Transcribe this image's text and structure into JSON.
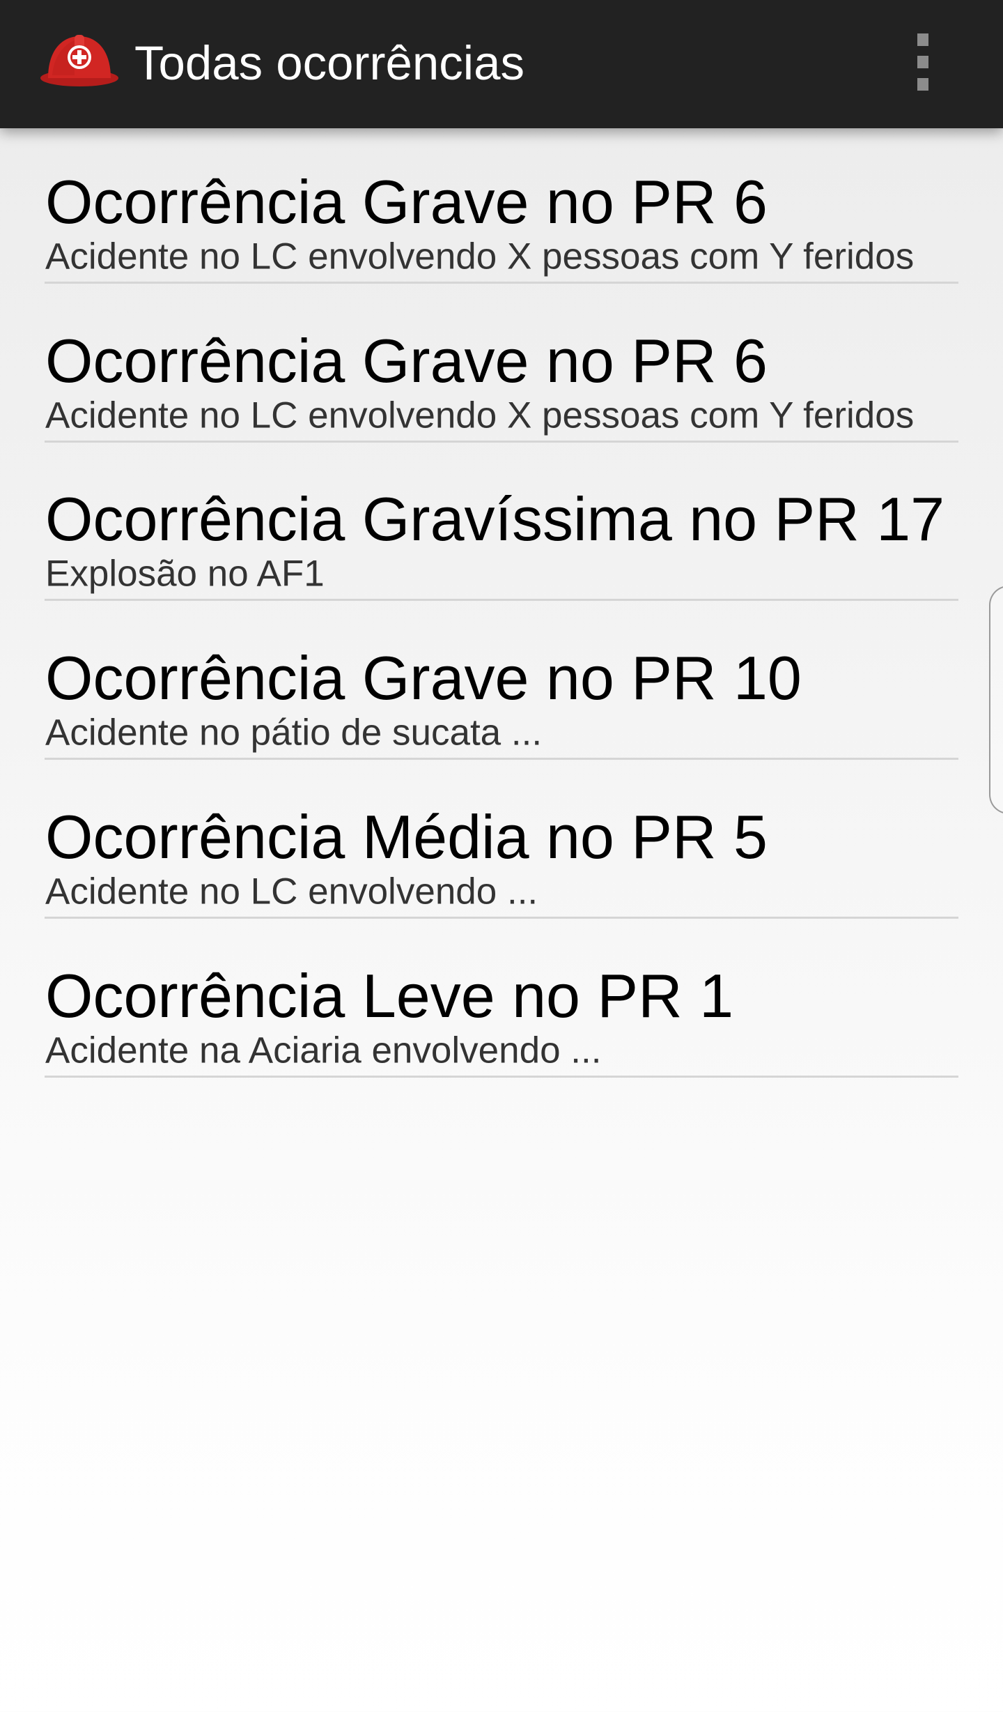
{
  "app_bar": {
    "title": "Todas ocorrências",
    "icon": "safety-helmet-icon",
    "menu_icon": "overflow-menu-icon",
    "background_color": "#222222"
  },
  "incidents": [
    {
      "title": "Ocorrência Grave no PR 6",
      "subtitle": "Acidente no LC envolvendo X pessoas com Y feridos"
    },
    {
      "title": "Ocorrência Grave no PR 6",
      "subtitle": "Acidente no LC envolvendo X pessoas com Y feridos"
    },
    {
      "title": "Ocorrência Gravíssima no PR 17",
      "subtitle": "Explosão no AF1"
    },
    {
      "title": "Ocorrência Grave no PR 10",
      "subtitle": "Acidente no pátio de sucata ..."
    },
    {
      "title": "Ocorrência Média no PR 5",
      "subtitle": "Acidente no LC envolvendo ..."
    },
    {
      "title": "Ocorrência Leve no PR 1",
      "subtitle": "Acidente na Aciaria envolvendo ..."
    }
  ],
  "colors": {
    "helmet_red": "#c8221f",
    "text_primary": "#000000",
    "text_secondary": "#333333",
    "divider": "#d5d5d5"
  }
}
